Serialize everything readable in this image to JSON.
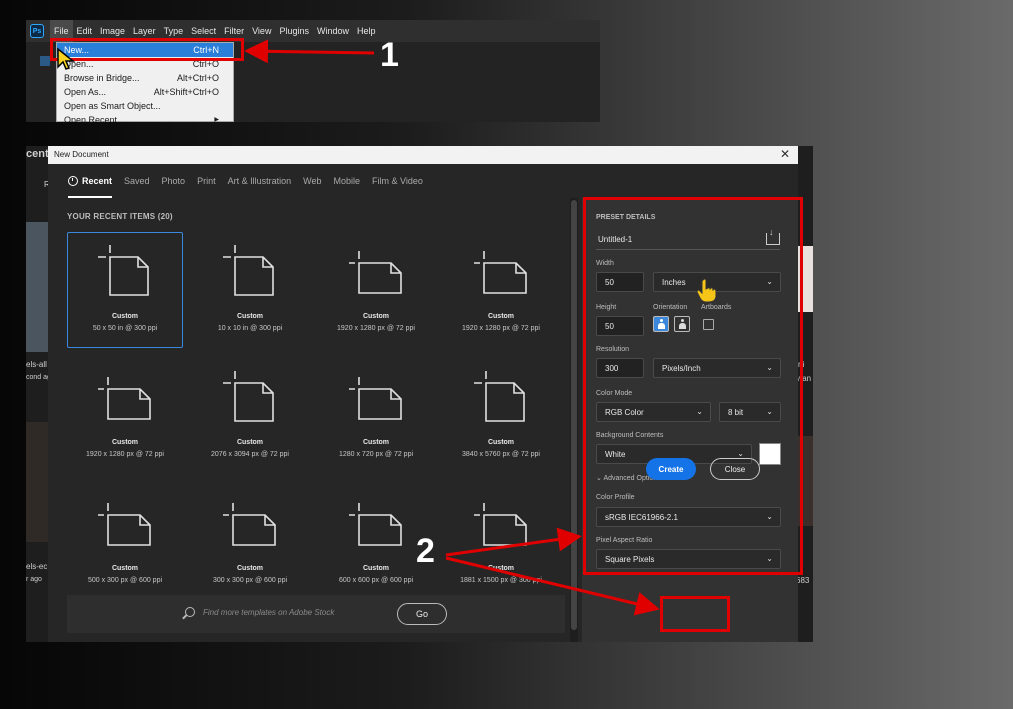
{
  "ps_menubar": {
    "logo": "Ps",
    "items": [
      "File",
      "Edit",
      "Image",
      "Layer",
      "Type",
      "Select",
      "Filter",
      "View",
      "Plugins",
      "Window",
      "Help"
    ]
  },
  "file_menu": {
    "items": [
      {
        "label": "New...",
        "shortcut": "Ctrl+N"
      },
      {
        "label": "Open...",
        "shortcut": "Ctrl+O"
      },
      {
        "label": "Browse in Bridge...",
        "shortcut": "Alt+Ctrl+O"
      },
      {
        "label": "Open As...",
        "shortcut": "Alt+Shift+Ctrl+O"
      },
      {
        "label": "Open as Smart Object...",
        "shortcut": ""
      },
      {
        "label": "Open Recent",
        "shortcut": ""
      }
    ]
  },
  "background_left": {
    "recent": "cent",
    "letter": "R",
    "text1": "els-all",
    "text2": "cond ag",
    "text3": "els-ec",
    "text4": "r ago"
  },
  "background_right": {
    "text1": "ni",
    "text2": "y an",
    "text3": "683"
  },
  "dialog": {
    "title": "New Document",
    "close_glyph": "✕",
    "tabs": [
      "Recent",
      "Saved",
      "Photo",
      "Print",
      "Art & Illustration",
      "Web",
      "Mobile",
      "Film & Video"
    ],
    "recent_heading": "YOUR RECENT ITEMS  (20)",
    "tiles": [
      {
        "name": "Custom",
        "size": "50 x 50 in @ 300 ppi",
        "shape": "portrait"
      },
      {
        "name": "Custom",
        "size": "10 x 10 in @ 300 ppi",
        "shape": "portrait"
      },
      {
        "name": "Custom",
        "size": "1920 x 1280 px @ 72 ppi",
        "shape": "landscape"
      },
      {
        "name": "Custom",
        "size": "1920 x 1280 px @ 72 ppi",
        "shape": "landscape"
      },
      {
        "name": "Custom",
        "size": "1920 x 1280 px @ 72 ppi",
        "shape": "landscape"
      },
      {
        "name": "Custom",
        "size": "2076 x 3094 px @ 72 ppi",
        "shape": "portrait"
      },
      {
        "name": "Custom",
        "size": "1280 x 720 px @ 72 ppi",
        "shape": "landscape"
      },
      {
        "name": "Custom",
        "size": "3840 x 5760 px @ 72 ppi",
        "shape": "portrait"
      },
      {
        "name": "Custom",
        "size": "500 x 300 px @ 600 ppi",
        "shape": "landscape"
      },
      {
        "name": "Custom",
        "size": "300 x 300 px @ 600 ppi",
        "shape": "landscape"
      },
      {
        "name": "Custom",
        "size": "600 x 600 px @ 600 ppi",
        "shape": "landscape"
      },
      {
        "name": "Custom",
        "size": "1881 x 1500 px @ 300 ppi",
        "shape": "landscape"
      }
    ],
    "search_placeholder": "Find more templates on Adobe Stock",
    "go_label": "Go",
    "preset": {
      "heading": "PRESET DETAILS",
      "name": "Untitled-1",
      "width_label": "Width",
      "width_value": "50",
      "width_unit": "Inches",
      "height_label": "Height",
      "height_value": "50",
      "orientation_label": "Orientation",
      "artboards_label": "Artboards",
      "resolution_label": "Resolution",
      "resolution_value": "300",
      "resolution_unit": "Pixels/Inch",
      "color_mode_label": "Color Mode",
      "color_mode": "RGB Color",
      "bit_depth": "8 bit",
      "bg_contents_label": "Background Contents",
      "bg_contents": "White",
      "advanced_label": "Advanced Options",
      "color_profile_label": "Color Profile",
      "color_profile": "sRGB IEC61966-2.1",
      "pixel_aspect_label": "Pixel Aspect Ratio",
      "pixel_aspect": "Square Pixels",
      "bg_swatch_color": "#ffffff"
    },
    "create_label": "Create",
    "close_label": "Close"
  },
  "annotations": {
    "step1": "1",
    "step2": "2",
    "highlight_color": "#e00000"
  }
}
